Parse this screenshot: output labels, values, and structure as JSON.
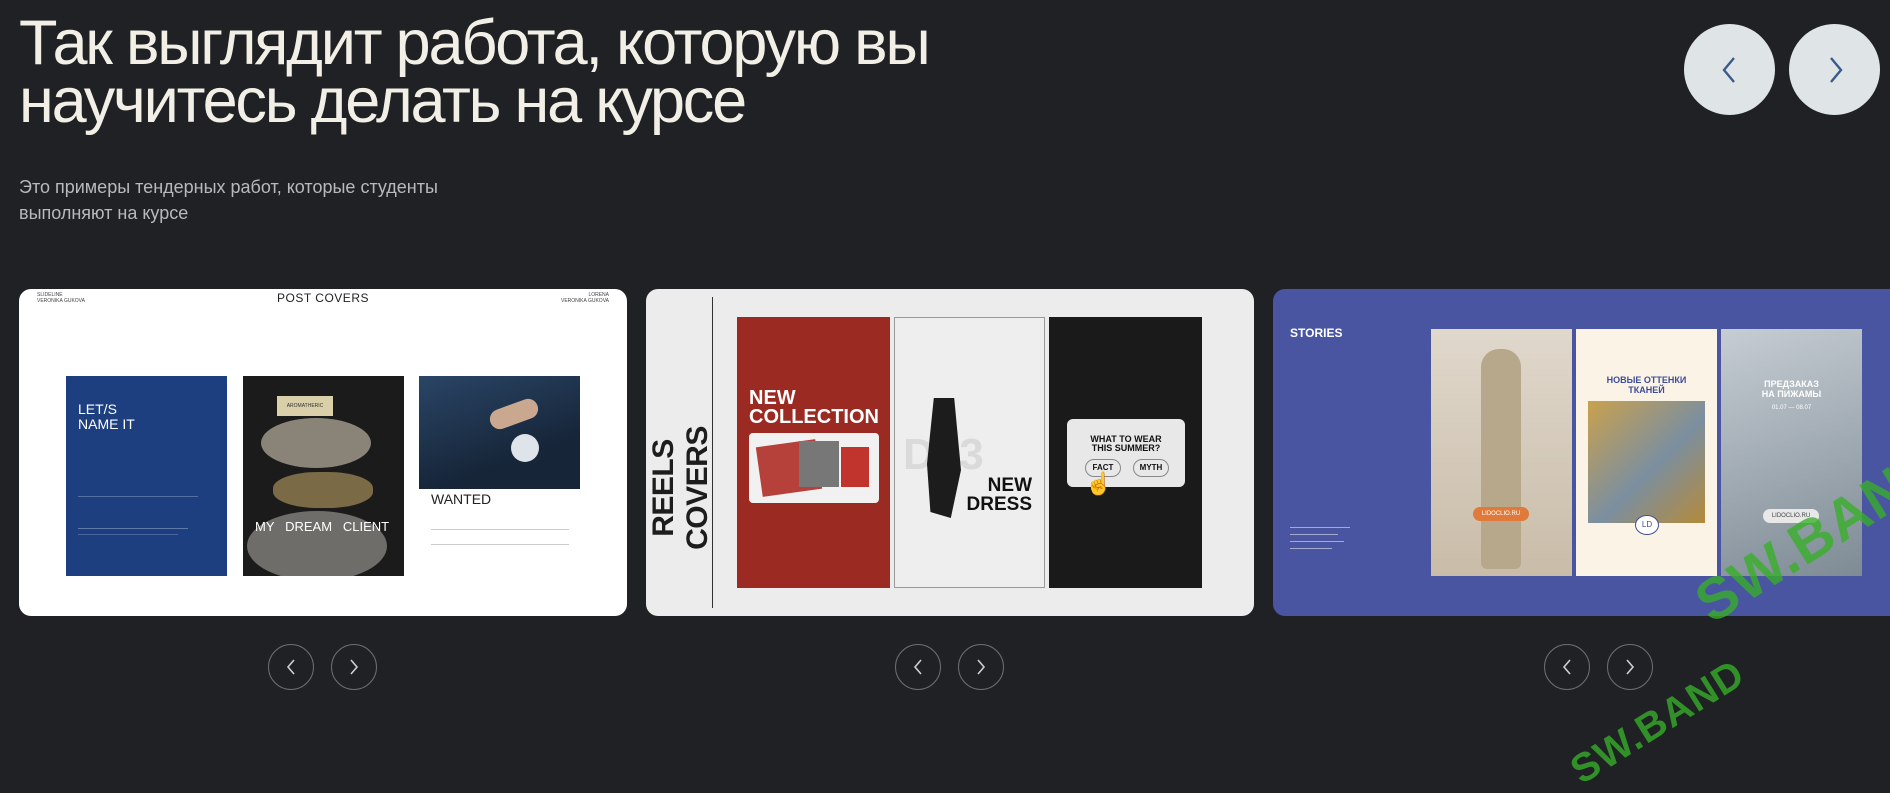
{
  "header": {
    "title_line1": "Так выглядит работа, которую вы",
    "title_line2": "научитесь делать на курсе",
    "subtitle_line1": "Это примеры тендерных работ, которые студенты",
    "subtitle_line2": "выполняют на курсе"
  },
  "cards": [
    {
      "heading": "POST COVERS",
      "corner_left": "SLIDELINE\nVERONIKA GUKOVA",
      "corner_right": "LORENA\nVERONIKA GUKOVA",
      "poster1_title": "LET/S\nNAME IT",
      "poster2_tag": "AROMATHERIC",
      "poster2_text": "MY   DREAM   CLIENT",
      "poster3_text": "WANTED"
    },
    {
      "vertical_title": "REELS COVERS",
      "panel1_text": "NEW\nCOLLECTION",
      "panel2_bg_text": "D23",
      "panel2_text": "NEW\nDRESS",
      "panel3_question": "WHAT TO WEAR\nTHIS SUMMER?",
      "panel3_option1": "FACT",
      "panel3_option2": "MYTH"
    },
    {
      "heading": "STORIES",
      "story1_button": "LIDOCLIO.RU",
      "story2_title": "НОВЫЕ ОТТЕНКИ\nТКАНЕЙ",
      "story2_logo": "LD",
      "story3_title": "ПРЕДЗАКАЗ\nНА ПИЖАМЫ",
      "story3_dates": "01.07 — 08.07",
      "story3_button": "LIDOCLIO.RU"
    }
  ],
  "watermark": "SW.BAND",
  "colors": {
    "background": "#1f2124",
    "nav_button": "#dfe4e6",
    "stories_bg": "#4a55a2",
    "reels_red": "#9b2a22",
    "post_blue": "#1d3f80"
  }
}
